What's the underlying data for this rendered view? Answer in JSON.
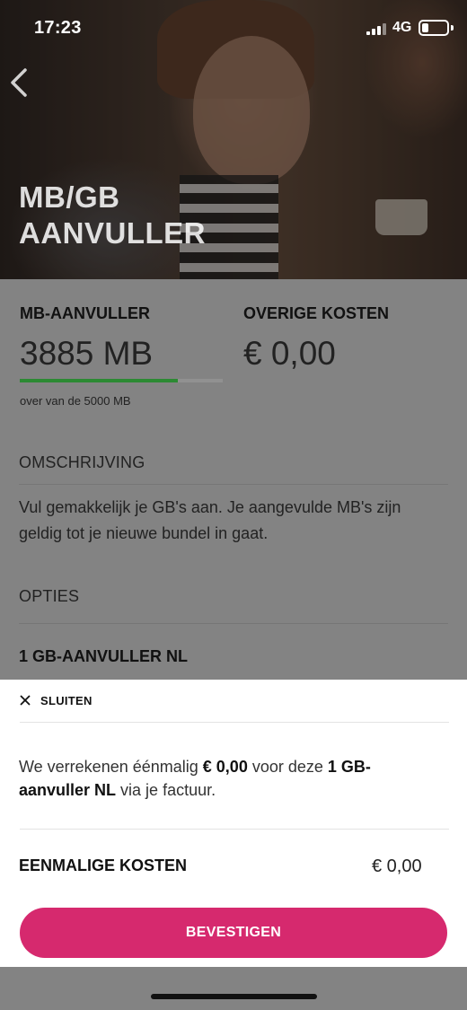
{
  "status_bar": {
    "time": "17:23",
    "network": "4G",
    "signal_bars": 4,
    "battery_level": 0.25
  },
  "header": {
    "title_line1": "MB/GB",
    "title_line2": "AANVULLER",
    "back_icon": "chevron-left-icon"
  },
  "details": {
    "mb_title": "MB-AANVULLER",
    "mb_value": "3885 MB",
    "mb_remaining_fraction": 0.777,
    "mb_note": "over van de 5000 MB",
    "other_title": "OVERIGE KOSTEN",
    "other_value": "€ 0,00",
    "description_title": "OMSCHRIJVING",
    "description_text": "Vul gemakkelijk je GB's aan. Je aangevulde MB's zijn geldig tot je nieuwe bundel in gaat.",
    "options_title": "OPTIES",
    "option_1": "1 GB-AANVULLER NL"
  },
  "sheet": {
    "close_label": "SLUITEN",
    "close_icon": "close-icon",
    "text_prefix": "We verrekenen éénmalig ",
    "text_amount": "€ 0,00",
    "text_middle": " voor deze ",
    "text_product": "1 GB-aanvuller NL",
    "text_suffix": " via je factuur.",
    "cost_label": "EENMALIGE KOSTEN",
    "cost_value": "€ 0,00",
    "confirm_label": "BEVESTIGEN"
  },
  "colors": {
    "accent": "#d6296e",
    "progress": "#2c8a33",
    "overlay": "#838383"
  }
}
